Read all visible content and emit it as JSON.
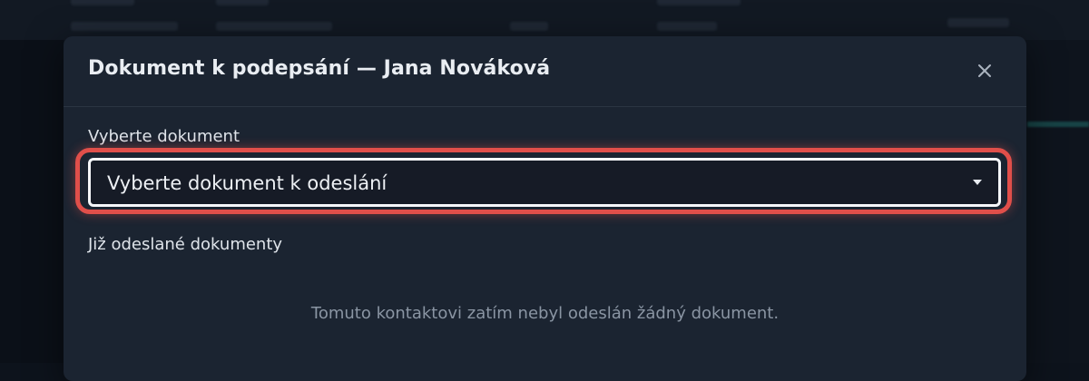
{
  "dialog": {
    "title": "Dokument k podepsání — Jana Nováková",
    "close_icon": "close-icon"
  },
  "document_select": {
    "label": "Vyberte dokument",
    "selected_value": "Vyberte dokument k odeslání",
    "caret_icon": "caret-down-icon",
    "highlight_color": "#e04f4a"
  },
  "sent_documents": {
    "label": "Již odeslané dokumenty",
    "empty_message": "Tomuto kontaktovi zatím nebyl odeslán žádný dokument."
  },
  "colors": {
    "background": "#0e141d",
    "dialog_background": "#1b2431",
    "select_background": "#161b26"
  }
}
